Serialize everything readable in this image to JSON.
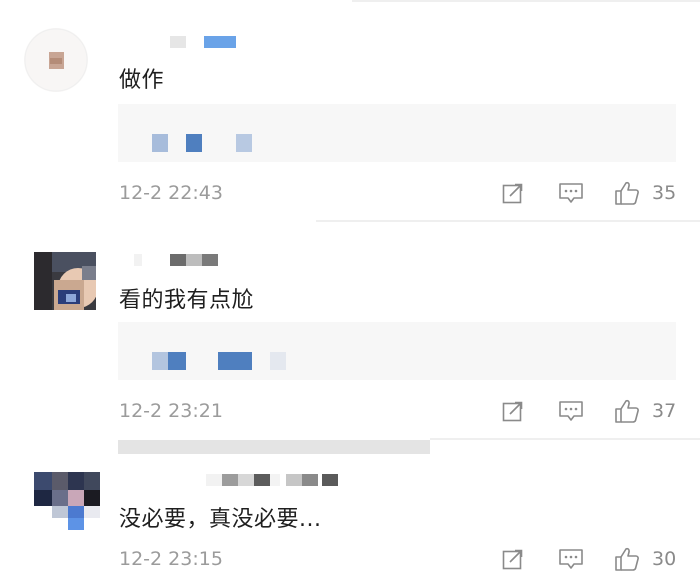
{
  "comments": [
    {
      "text": "做作",
      "time": "12-2 22:43",
      "likes": "35"
    },
    {
      "text": "看的我有点尬",
      "time": "12-2 23:21",
      "likes": "37"
    },
    {
      "text": "没必要，真没必要...",
      "time": "12-2 23:15",
      "likes": "30"
    }
  ],
  "icons": {
    "forward": "share-icon",
    "reply": "comment-icon",
    "like": "thumbs-up-icon"
  },
  "colors": {
    "text": "#1f1f1f",
    "meta": "#9b9b9b",
    "reply_bg": "#f7f7f7",
    "blur_blue": "#5b8fd6"
  }
}
